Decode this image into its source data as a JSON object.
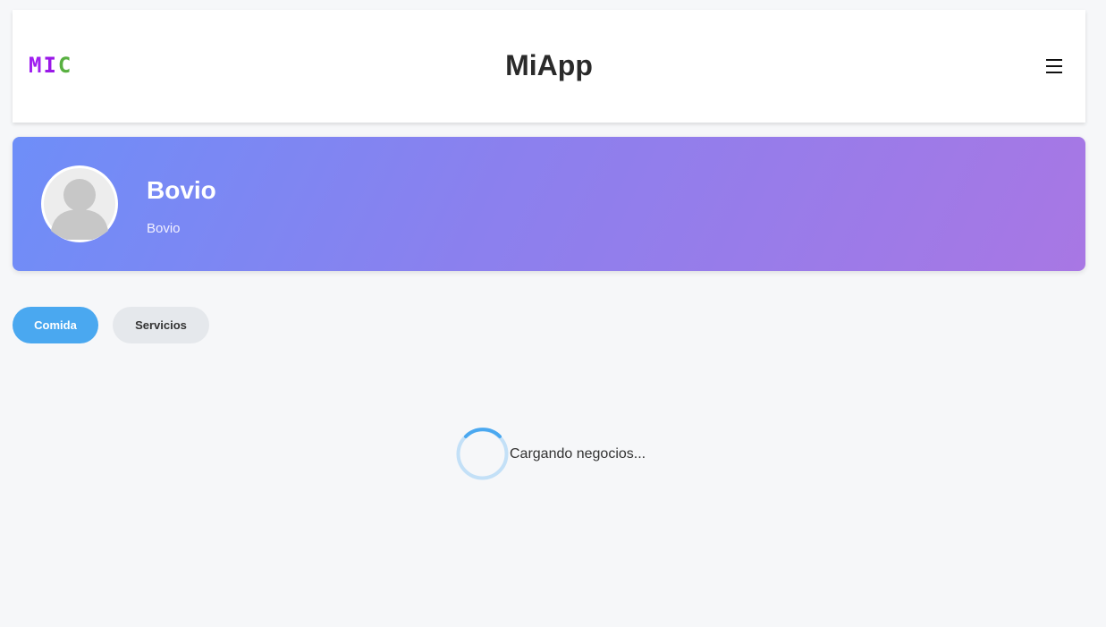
{
  "header": {
    "logo": {
      "letter1": "M",
      "letter2": "I",
      "letter3": "C"
    },
    "title": "MiApp",
    "menu_icon": "hamburger-menu-icon"
  },
  "profile": {
    "name": "Bovio",
    "subtitle": "Bovio",
    "avatar_icon": "user-placeholder-icon",
    "gradient": [
      "#6e8ef8",
      "#a877e4"
    ]
  },
  "tabs": [
    {
      "label": "Comida",
      "active": true
    },
    {
      "label": "Servicios",
      "active": false
    }
  ],
  "status": {
    "loading_text": "Cargando negocios...",
    "spinner_icon": "loading-spinner-icon"
  },
  "colors": {
    "accent": "#4aa8f0",
    "background": "#f6f7f9",
    "tab_inactive": "#e5e8ec"
  }
}
